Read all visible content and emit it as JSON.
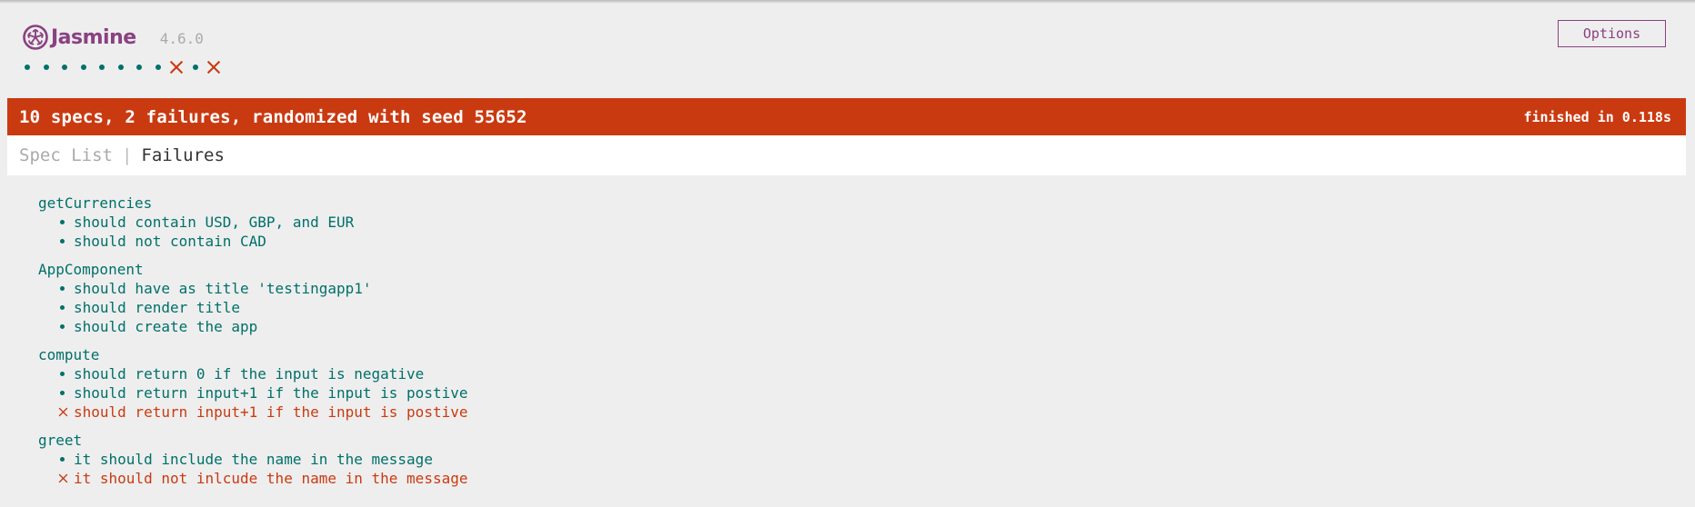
{
  "banner": {
    "logo_text": "Jasmine",
    "version": "4.6.0",
    "options_label": "Options"
  },
  "symbol_summary": [
    "passed",
    "passed",
    "passed",
    "passed",
    "passed",
    "passed",
    "passed",
    "passed",
    "failed",
    "passed",
    "failed"
  ],
  "alert": {
    "overall": "10 specs, 2 failures, randomized with seed 55652",
    "duration": "finished in 0.118s"
  },
  "menu": {
    "spec_list_label": "Spec List",
    "separator": "|",
    "failures_label": "Failures"
  },
  "suites": [
    {
      "title": "getCurrencies",
      "specs": [
        {
          "status": "passed",
          "label": "should contain USD, GBP, and EUR"
        },
        {
          "status": "passed",
          "label": "should not contain CAD"
        }
      ]
    },
    {
      "title": "AppComponent",
      "specs": [
        {
          "status": "passed",
          "label": "should have as title 'testingapp1'"
        },
        {
          "status": "passed",
          "label": "should render title"
        },
        {
          "status": "passed",
          "label": "should create the app"
        }
      ]
    },
    {
      "title": "compute",
      "specs": [
        {
          "status": "passed",
          "label": "should return 0 if the input is negative"
        },
        {
          "status": "passed",
          "label": "should return input+1 if the input is postive"
        },
        {
          "status": "failed",
          "label": "should return input+1 if the input is postive"
        }
      ]
    },
    {
      "title": "greet",
      "specs": [
        {
          "status": "passed",
          "label": "it should include the name in the message"
        },
        {
          "status": "failed",
          "label": "it should not inlcude the name in the message"
        }
      ]
    }
  ],
  "colors": {
    "passed": "#007069",
    "failed": "#ca3a11",
    "brand": "#8a4182",
    "background": "#eeeeee"
  }
}
